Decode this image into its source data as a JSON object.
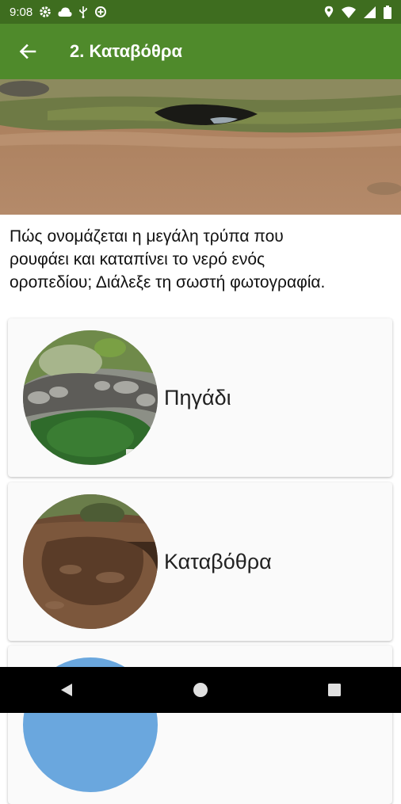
{
  "status_bar": {
    "time": "9:08",
    "left_icons": [
      "gear-icon",
      "cloud-icon",
      "usb-icon",
      "data-saver-icon"
    ],
    "right_icons": [
      "location-icon",
      "wifi-icon",
      "signal-icon",
      "battery-icon"
    ]
  },
  "app_bar": {
    "title": "2. Καταβόθρα",
    "back_icon": "arrow-back-icon",
    "color": "#4f8a2b"
  },
  "question": {
    "text": "Πώς ονομάζεται η μεγάλη τρύπα που ρουφάει και καταπίνει το νερό ενός οροπεδίου; Διάλεξε τη σωστή φωτογραφία."
  },
  "options": [
    {
      "label": "Πηγάδι"
    },
    {
      "label": "Καταβόθρα"
    },
    {
      "label": ""
    }
  ],
  "nav_bar": {
    "buttons": [
      "back-triangle-icon",
      "home-circle-icon",
      "recents-square-icon"
    ]
  }
}
